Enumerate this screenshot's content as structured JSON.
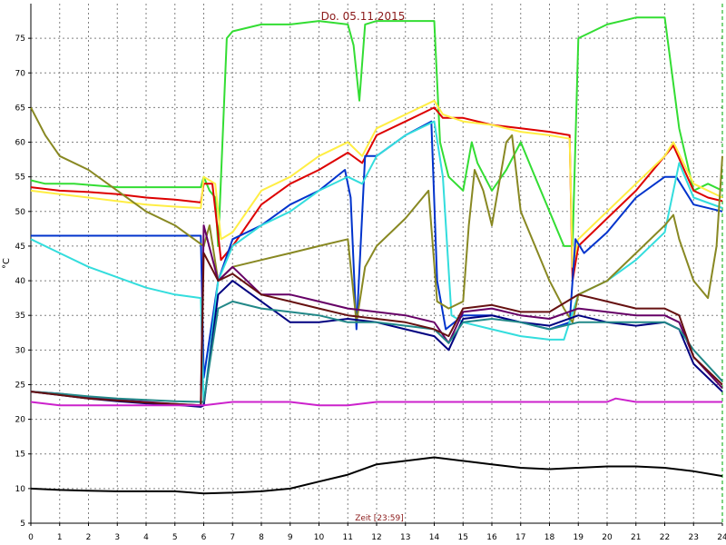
{
  "chart_data": {
    "type": "line",
    "title": "Do. 05.11.2015",
    "xlabel": "Zeit [23:59]",
    "ylabel": "°C",
    "xlim": [
      0,
      24
    ],
    "ylim": [
      5,
      80
    ],
    "xticks": [
      0,
      1,
      2,
      3,
      4,
      5,
      6,
      7,
      8,
      9,
      10,
      11,
      12,
      13,
      14,
      15,
      16,
      17,
      18,
      19,
      20,
      21,
      22,
      23,
      24
    ],
    "yticks": [
      5,
      10,
      15,
      20,
      25,
      30,
      35,
      40,
      45,
      50,
      55,
      60,
      65,
      70,
      75
    ],
    "grid": true,
    "legend": "none",
    "series": [
      {
        "color": "#33dd33",
        "x": [
          0,
          0.5,
          1.5,
          3,
          4,
          5,
          5.9,
          6,
          6.2,
          6.4,
          6.5,
          6.8,
          7,
          8,
          9,
          10,
          11,
          11.2,
          11.4,
          11.6,
          12,
          13,
          14,
          14.2,
          14.5,
          15,
          15.3,
          15.5,
          16,
          16.5,
          17,
          17.5,
          18,
          18.5,
          18.8,
          19,
          20,
          21,
          22,
          22.5,
          23,
          23.5,
          24
        ],
        "y": [
          54.5,
          54,
          54,
          53.5,
          53.5,
          53.5,
          53.5,
          55,
          53,
          52,
          45,
          75,
          76,
          77,
          77,
          77.5,
          77,
          74,
          66,
          77,
          77.5,
          77.5,
          77.5,
          60,
          55,
          53,
          60,
          57,
          53,
          56,
          60,
          55,
          50,
          45,
          45,
          75,
          77,
          78,
          78,
          62,
          53,
          54,
          53
        ]
      },
      {
        "color": "#dd0000",
        "x": [
          0,
          1,
          2,
          3,
          4,
          5,
          5.9,
          6,
          6.3,
          6.6,
          7,
          8,
          9,
          10,
          11,
          11.5,
          12,
          13,
          14,
          14.3,
          15,
          16,
          17,
          18,
          18.7,
          18.8,
          19,
          20,
          21,
          22,
          22.3,
          23,
          23.5,
          24
        ],
        "y": [
          53.5,
          53,
          52.8,
          52.5,
          52,
          51.7,
          51.3,
          54,
          54,
          43,
          45,
          51,
          54,
          56,
          58.5,
          57,
          61,
          63,
          65,
          63.5,
          63.5,
          62.5,
          62,
          61.5,
          61,
          40,
          45,
          49,
          53,
          58,
          59.5,
          53,
          52,
          51.5
        ]
      },
      {
        "color": "#ffee44",
        "x": [
          0,
          1,
          2,
          3,
          4,
          5,
          5.9,
          6,
          6.4,
          6.6,
          7,
          8,
          9,
          10,
          11,
          11.5,
          12,
          13,
          14,
          14.3,
          15,
          16,
          17,
          18,
          18.7,
          18.8,
          19,
          20,
          21,
          22,
          22.3,
          23,
          24
        ],
        "y": [
          53,
          52.5,
          52,
          51.5,
          51,
          50.7,
          50.5,
          55,
          54,
          46,
          47,
          53,
          55,
          58,
          60,
          58,
          62,
          64,
          66,
          64,
          63,
          62.5,
          61.5,
          61,
          60.5,
          42,
          46,
          50,
          54,
          58,
          60,
          54,
          52
        ]
      },
      {
        "color": "#0033cc",
        "x": [
          0,
          1,
          2,
          3,
          4,
          5,
          5.9,
          6,
          6.5,
          7,
          8,
          9,
          10,
          10.9,
          11.1,
          11.3,
          11.6,
          12,
          13,
          13.9,
          14.1,
          14.4,
          15,
          16,
          17,
          18,
          18.7,
          18.9,
          19.2,
          20,
          21,
          22,
          22.4,
          23,
          24
        ],
        "y": [
          46.5,
          46.5,
          46.5,
          46.5,
          46.5,
          46.5,
          46.5,
          26,
          40,
          46,
          48,
          51,
          53,
          56,
          52,
          33,
          58,
          58,
          61,
          63,
          40,
          33,
          35,
          35,
          34,
          33,
          34,
          46,
          44,
          47,
          52,
          55,
          55,
          51,
          50
        ]
      },
      {
        "color": "#33dddd",
        "x": [
          0,
          1,
          2,
          3,
          4,
          5,
          5.9,
          6,
          6.5,
          7,
          8,
          9,
          10,
          11,
          11.5,
          12,
          13,
          14,
          14.3,
          14.6,
          15,
          16,
          17,
          18,
          18.5,
          19,
          20,
          21,
          22,
          22.5,
          23,
          24
        ],
        "y": [
          46,
          44,
          42,
          40.5,
          39,
          38,
          37.5,
          22,
          40,
          45,
          48,
          50,
          53,
          55,
          54,
          58,
          61,
          63,
          55,
          35,
          34,
          33,
          32,
          31.5,
          31.5,
          38,
          40,
          43,
          47,
          57,
          52,
          50.5
        ]
      },
      {
        "color": "#888822",
        "x": [
          0,
          0.5,
          1,
          2,
          3,
          4,
          5,
          6,
          6.2,
          6.5,
          7,
          8,
          9,
          10,
          11,
          11.3,
          11.6,
          12,
          13,
          13.8,
          14.1,
          14.5,
          15,
          15.2,
          15.4,
          15.7,
          16,
          16.5,
          16.7,
          17,
          17.5,
          18,
          18.5,
          18.8,
          19,
          20,
          21,
          22,
          22.3,
          22.5,
          23,
          23.5,
          23.8,
          24
        ],
        "y": [
          65,
          61,
          58,
          56,
          53,
          50,
          48,
          45,
          48,
          40,
          42,
          43,
          44,
          45,
          46,
          34,
          42,
          45,
          49,
          53,
          37,
          36,
          37,
          48,
          56,
          53,
          48,
          60,
          61,
          50,
          45,
          40,
          36,
          34,
          38,
          40,
          44,
          48,
          49.5,
          46,
          40,
          37.5,
          45,
          58
        ]
      },
      {
        "color": "#000080",
        "x": [
          0,
          1,
          2,
          3,
          4,
          5,
          5.9,
          6,
          6.5,
          7,
          8,
          9,
          10,
          11,
          12,
          13,
          14,
          14.5,
          15,
          16,
          17,
          18,
          19,
          20,
          21,
          22,
          22.5,
          23,
          24
        ],
        "y": [
          24,
          23.5,
          23,
          22.6,
          22.3,
          22.1,
          21.8,
          22,
          38,
          40,
          37,
          34,
          34,
          34.5,
          34,
          33,
          32,
          30,
          34.5,
          35,
          34,
          33.5,
          35,
          34,
          33.5,
          34,
          33,
          28,
          24
        ]
      },
      {
        "color": "#660066",
        "x": [
          0,
          1,
          2,
          3,
          4,
          5,
          5.9,
          6,
          6.5,
          7,
          8,
          9,
          10,
          11,
          12,
          13,
          14,
          14.5,
          15,
          16,
          17,
          18,
          19,
          20,
          21,
          22,
          22.5,
          23,
          24
        ],
        "y": [
          24,
          23.7,
          23.2,
          22.8,
          22.5,
          22.2,
          22,
          48,
          40,
          42,
          38,
          38,
          37,
          36,
          35.5,
          35,
          34,
          31,
          35.5,
          36,
          35,
          34.5,
          36,
          35.5,
          35,
          35,
          34,
          29,
          24.5
        ]
      },
      {
        "color": "#228888",
        "x": [
          0,
          1,
          2,
          3,
          4,
          5,
          5.9,
          6,
          6.5,
          7,
          8,
          9,
          10,
          11,
          12,
          13,
          14,
          14.5,
          15,
          16,
          17,
          18,
          19,
          20,
          21,
          22,
          22.5,
          23,
          24
        ],
        "y": [
          24,
          23.7,
          23.3,
          23,
          22.8,
          22.6,
          22.5,
          22.5,
          36,
          37,
          36,
          35.5,
          35,
          34,
          34,
          33.5,
          33,
          31,
          34,
          34.5,
          34,
          33,
          34,
          34,
          34,
          34,
          33,
          30,
          25.5
        ]
      },
      {
        "color": "#661111",
        "x": [
          0,
          1,
          2,
          3,
          4,
          5,
          5.9,
          6,
          6.5,
          7,
          8,
          9,
          10,
          11,
          12,
          13,
          14,
          14.5,
          15,
          16,
          17,
          18,
          19,
          20,
          21,
          22,
          22.5,
          23,
          24
        ],
        "y": [
          24,
          23.5,
          23,
          22.7,
          22.4,
          22.2,
          22,
          44,
          40,
          41,
          38,
          37,
          36,
          35,
          34.5,
          34,
          33,
          32,
          36,
          36.5,
          35.5,
          35.5,
          38,
          37,
          36,
          36,
          35,
          29,
          25
        ]
      },
      {
        "color": "#cc22cc",
        "x": [
          0,
          1,
          2,
          3,
          4,
          5,
          6,
          7,
          8,
          9,
          10,
          11,
          12,
          13,
          14,
          15,
          16,
          17,
          18,
          19,
          20,
          20.3,
          21,
          22,
          23,
          24
        ],
        "y": [
          22.5,
          22,
          22,
          22,
          22,
          22,
          22,
          22.5,
          22.5,
          22.5,
          22,
          22,
          22.5,
          22.5,
          22.5,
          22.5,
          22.5,
          22.5,
          22.5,
          22.5,
          22.5,
          23,
          22.5,
          22.5,
          22.5,
          22.5
        ]
      },
      {
        "color": "#000000",
        "x": [
          0,
          1,
          2,
          3,
          4,
          5,
          6,
          7,
          8,
          9,
          10,
          11,
          12,
          13,
          14,
          15,
          16,
          17,
          18,
          19,
          20,
          21,
          22,
          23,
          24
        ],
        "y": [
          10,
          9.8,
          9.7,
          9.6,
          9.6,
          9.6,
          9.3,
          9.4,
          9.6,
          10,
          11,
          12,
          13.5,
          14,
          14.5,
          14,
          13.5,
          13,
          12.8,
          13,
          13.2,
          13.2,
          13,
          12.5,
          11.8
        ]
      }
    ]
  }
}
